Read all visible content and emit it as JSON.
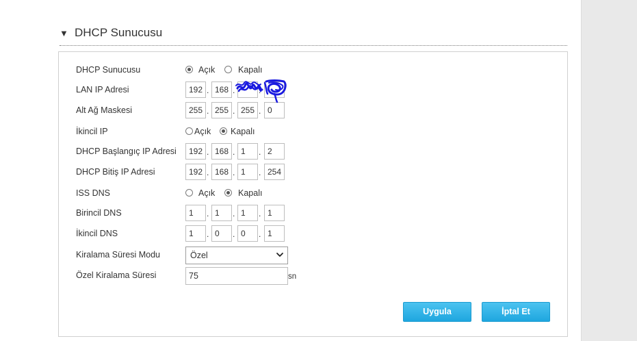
{
  "section": {
    "title": "DHCP Sunucusu",
    "collapse_icon": "triangle-down-icon"
  },
  "form": {
    "dhcp_server": {
      "label": "DHCP Sunucusu",
      "selected": "on",
      "on_label": "Açık",
      "off_label": "Kapalı"
    },
    "lan_ip": {
      "label": "LAN IP Adresi",
      "octets": [
        "192",
        "168",
        "",
        ""
      ]
    },
    "subnet_mask": {
      "label": "Alt Ağ Maskesi",
      "octets": [
        "255",
        "255",
        "255",
        "0"
      ]
    },
    "secondary_ip": {
      "label": "İkincil IP",
      "selected": "off",
      "on_label": "Açık",
      "off_label": "Kapalı"
    },
    "dhcp_start": {
      "label": "DHCP Başlangıç IP Adresi",
      "octets": [
        "192",
        "168",
        "1",
        "2"
      ]
    },
    "dhcp_end": {
      "label": "DHCP Bitiş IP Adresi",
      "octets": [
        "192",
        "168",
        "1",
        "254"
      ]
    },
    "isp_dns": {
      "label": "ISS DNS",
      "selected": "off",
      "on_label": "Açık",
      "off_label": "Kapalı"
    },
    "primary_dns": {
      "label": "Birincil DNS",
      "octets": [
        "1",
        "1",
        "1",
        "1"
      ]
    },
    "secondary_dns": {
      "label": "İkincil DNS",
      "octets": [
        "1",
        "0",
        "0",
        "1"
      ]
    },
    "lease_mode": {
      "label": "Kiralama Süresi Modu",
      "value": "Özel"
    },
    "custom_lease": {
      "label": "Özel Kiralama Süresi",
      "value": "75",
      "unit": "sn"
    }
  },
  "buttons": {
    "apply": "Uygula",
    "cancel": "İptal Et"
  },
  "colors": {
    "button": "#1ea6df",
    "redaction": "#1a1adf"
  }
}
